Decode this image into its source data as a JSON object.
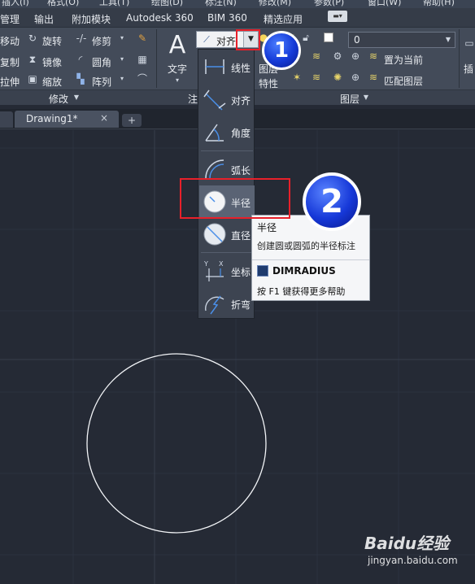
{
  "menu_top": [
    "插入(I)",
    "格式(O)",
    "工具(T)",
    "绘图(D)",
    "标注(N)",
    "修改(M)",
    "参数(P)",
    "窗口(W)",
    "帮助(H)"
  ],
  "ribbon_tabs": [
    "管理",
    "输出",
    "附加模块",
    "Autodesk 360",
    "BIM 360",
    "精选应用"
  ],
  "modify_panel": {
    "row1": [
      "移动",
      "旋转",
      "修剪"
    ],
    "row2": [
      "复制",
      "镜像",
      "圆角"
    ],
    "row3": [
      "拉伸",
      "缩放",
      "阵列"
    ],
    "title": "修改"
  },
  "annotation_panel": {
    "text_label": "文字",
    "title": "注",
    "combo_value": "对齐"
  },
  "layers_panel": {
    "layer_value": "0",
    "props_label": "图层特性",
    "props_line1": "图层",
    "props_line2": "特性",
    "set_current": "置为当前",
    "match_layer": "匹配图层",
    "title": "图层"
  },
  "right_panel_label": "插",
  "doc_tab": {
    "name": "Drawing1*",
    "close": "×",
    "add": "+"
  },
  "dimension_dropdown": {
    "items": [
      {
        "label": "线性",
        "icon": "linear-dimension-icon"
      },
      {
        "label": "对齐",
        "icon": "aligned-dimension-icon"
      },
      {
        "label": "角度",
        "icon": "angular-dimension-icon"
      },
      {
        "label": "弧长",
        "icon": "arc-length-icon"
      },
      {
        "label": "半径",
        "icon": "radius-dimension-icon"
      },
      {
        "label": "直径",
        "icon": "diameter-dimension-icon"
      },
      {
        "label": "坐标",
        "icon": "ordinate-dimension-icon"
      },
      {
        "label": "折弯",
        "icon": "jogged-dimension-icon"
      }
    ]
  },
  "tooltip": {
    "title": "半径",
    "description": "创建圆或圆弧的半径标注",
    "command": "DIMRADIUS",
    "help": "按 F1 键获得更多帮助"
  },
  "annotation_badges": [
    "1",
    "2"
  ],
  "watermark": {
    "brand": "Baidu经验",
    "url": "jingyan.baidu.com"
  },
  "colors": {
    "canvas_bg": "#252a35",
    "ribbon_bg": "#434b59",
    "highlight_red": "#e8202a",
    "badge_blue": "#1439d6"
  }
}
